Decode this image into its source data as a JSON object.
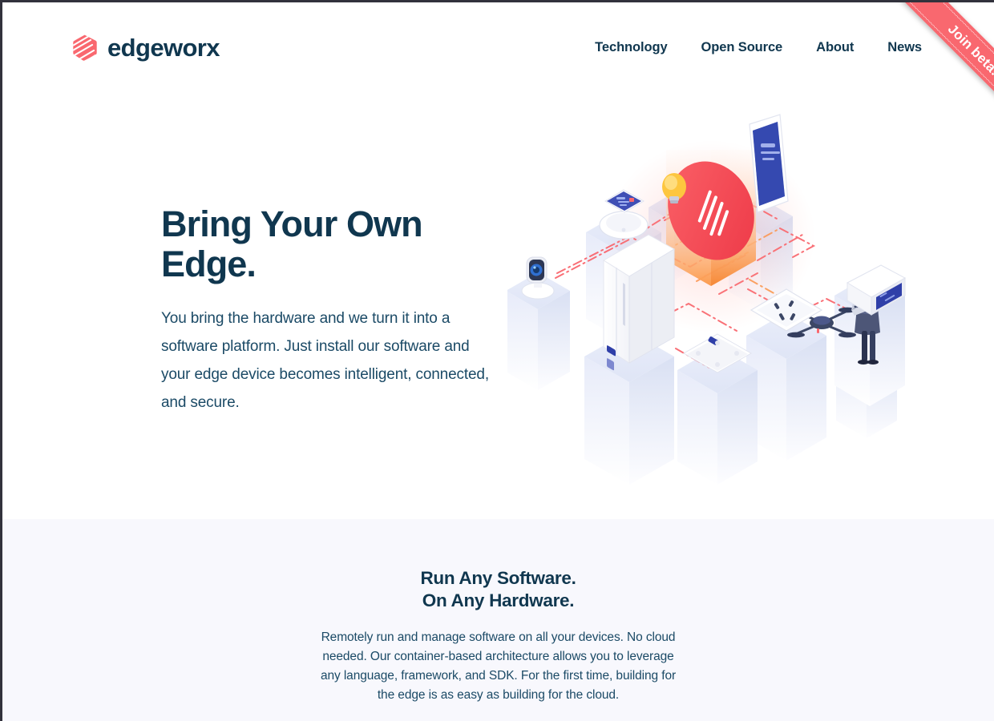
{
  "brand": {
    "name": "edgeworx",
    "logo_icon": "edgeworx-striped-hexagon-icon",
    "logo_color": "#f9686f",
    "text_color": "#10374f"
  },
  "nav": {
    "items": [
      {
        "label": "Technology"
      },
      {
        "label": "Open Source"
      },
      {
        "label": "About"
      },
      {
        "label": "News"
      }
    ]
  },
  "ribbon": {
    "label": "Join beta!",
    "color": "#f9686f",
    "text_color": "#ffffff"
  },
  "hero": {
    "title": "Bring Your Own Edge.",
    "subtitle": "You bring the hardware and we turn it into a software platform. Just install our software and your edge device becomes intelligent, connected, and secure.",
    "illustration": {
      "name": "isometric-edge-devices-network",
      "center_node": "edgeworx-hexagon-prism-badge",
      "accent_color": "#f9686f",
      "pedestal_color": "#e4e8f7",
      "connection_style": "dash-dot",
      "devices": [
        "security-camera-icon",
        "smartwatch-icon",
        "refrigerator-icon",
        "lightbulb-icon",
        "tablet-icon",
        "drone-icon",
        "person-with-laptop-icon",
        "power-outlet-icon",
        "server-box-icon",
        "smart-scale-icon"
      ]
    }
  },
  "section": {
    "title": "Run Any Software.\nOn Any Hardware.",
    "body": "Remotely run and manage software on all your devices. No cloud needed. Our container-based architecture allows you to leverage any language, framework, and SDK. For the first time, building for the edge is as easy as building for the cloud.",
    "background": "#f8f8fd"
  }
}
